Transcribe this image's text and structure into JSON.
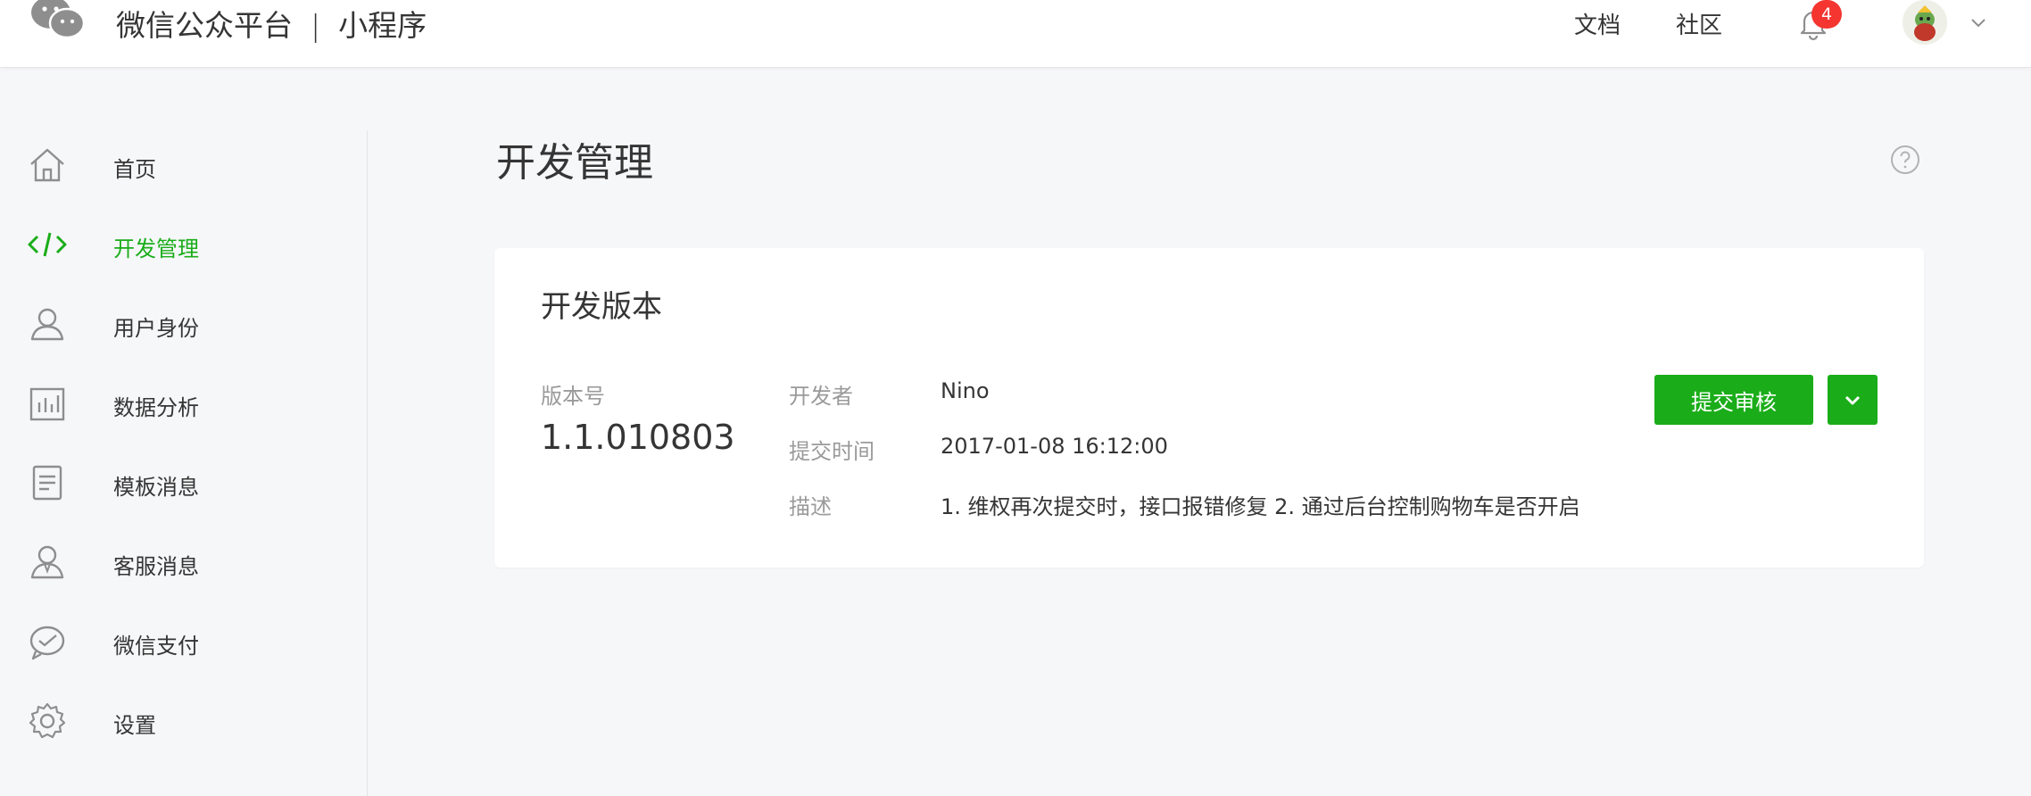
{
  "header": {
    "brand_name": "微信公众平台",
    "separator": "|",
    "product_name": "小程序",
    "links": [
      "文档",
      "社区"
    ],
    "notification_count": "4"
  },
  "sidebar": {
    "items": [
      {
        "label": "首页",
        "icon": "home-icon"
      },
      {
        "label": "开发管理",
        "icon": "code-icon",
        "active": true
      },
      {
        "label": "用户身份",
        "icon": "user-icon"
      },
      {
        "label": "数据分析",
        "icon": "chart-icon"
      },
      {
        "label": "模板消息",
        "icon": "document-icon"
      },
      {
        "label": "客服消息",
        "icon": "customer-service-icon"
      },
      {
        "label": "微信支付",
        "icon": "wechat-pay-icon"
      },
      {
        "label": "设置",
        "icon": "settings-icon"
      }
    ]
  },
  "main": {
    "title": "开发管理",
    "card": {
      "title": "开发版本",
      "version_label": "版本号",
      "version_value": "1.1.010803",
      "developer_label": "开发者",
      "developer_value": "Nino",
      "time_label": "提交时间",
      "time_value": "2017-01-08 16:12:00",
      "desc_label": "描述",
      "desc_value": "1. 维权再次提交时，接口报错修复 2. 通过后台控制购物车是否开启",
      "submit_button": "提交审核"
    }
  },
  "colors": {
    "accent": "#1aad19",
    "badge": "#f43530"
  }
}
